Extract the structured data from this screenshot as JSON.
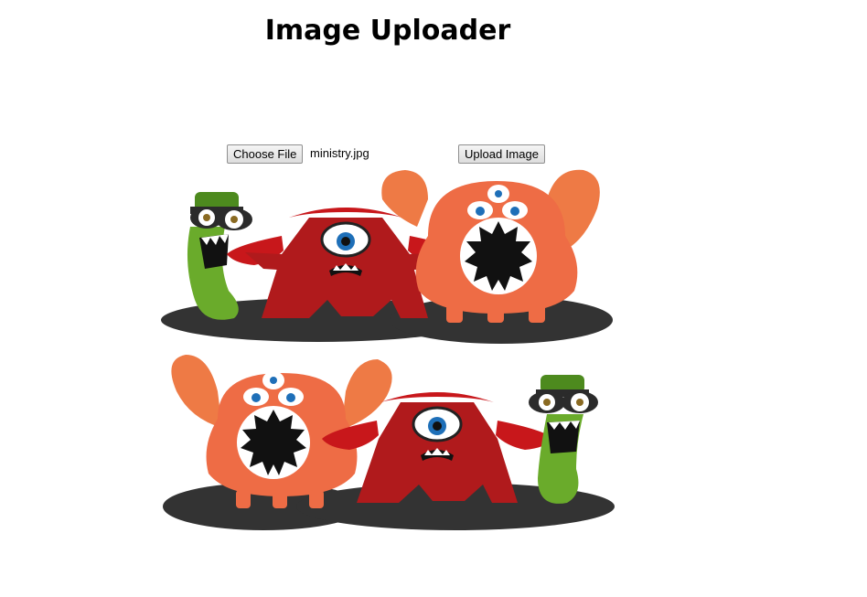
{
  "page": {
    "title": "Image Uploader"
  },
  "uploader": {
    "choose_file_label": "Choose File",
    "selected_file_name": "ministry.jpg",
    "upload_label": "Upload Image"
  },
  "preview": {
    "image_description_icon": "monsters-illustration"
  },
  "colors": {
    "monster_red": "#c8171b",
    "monster_orange": "#ee6c45",
    "monster_green": "#6aab2b",
    "shadow": "#333333"
  }
}
